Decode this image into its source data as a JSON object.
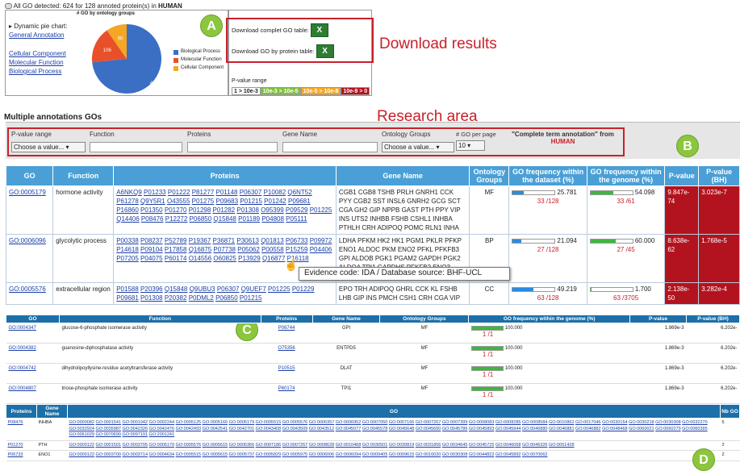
{
  "header": {
    "icon": "database-icon",
    "prefix": "All GO detected: 624 for 128 annoted protein(s) in",
    "species": "HUMAN"
  },
  "pie": {
    "side_title": "Dynamic pie chart:",
    "links": [
      "General Annotation",
      "Cellular Component",
      "Molecular Function",
      "Biological Process"
    ],
    "chart_title": "# GO by ontology groups"
  },
  "chart_data": {
    "type": "pie",
    "title": "# GO by ontology groups",
    "labels": [
      "Biological Process",
      "Molecular Function",
      "Cellular Component"
    ],
    "values": [
      458,
      106,
      60
    ],
    "colors": [
      "#3a6fc4",
      "#e8502a",
      "#f5a623"
    ]
  },
  "download": {
    "complete_label": "Download complet GO table:",
    "byprotein_label": "Download GO by protein table:",
    "xls_icon": "excel-icon",
    "pvalue_title": "P-value range",
    "pvalue_bins": [
      {
        "t": "1 > 10e-3",
        "c": "#ffffff",
        "f": "#222"
      },
      {
        "t": "10e-3 > 10e-5",
        "c": "#7fbf3f",
        "f": "#fff"
      },
      {
        "t": "10e-5 > 10e-8",
        "c": "#f5a623",
        "f": "#fff"
      },
      {
        "t": "10e-9 > 0",
        "c": "#b3131e",
        "f": "#fff"
      }
    ]
  },
  "annotations": {
    "A": "Download results",
    "B": "Research area",
    "letters": [
      "A",
      "B",
      "C",
      "D"
    ]
  },
  "search": {
    "title": "Multiple annotations GOs",
    "pvalue_label": "P-value range",
    "pvalue_select": "Choose a value...",
    "function_label": "Function",
    "proteins_label": "Proteins",
    "gene_label": "Gene Name",
    "onto_label": "Ontology Groups",
    "onto_select": "Choose a value...",
    "goperpage_label": "# GO per page",
    "goperpage_value": "10",
    "complete_label": "\"Complete term annotation\" from",
    "complete_species": "HUMAN"
  },
  "table1": {
    "headers": [
      "GO",
      "Function",
      "Proteins",
      "Gene Name",
      "Ontology Groups",
      "GO frequency within the dataset (%)",
      "GO frequency within the genome (%)",
      "P-value",
      "P-value (BH)"
    ],
    "rows": [
      {
        "go": "GO:0005179",
        "function": "hormone activity",
        "proteins": "A6NKQ9 P01233 P01222 P81277 P01148 P06307 P10082 Q6NT52 P61278 Q9Y5R1 O43555 P01275 P09683 P01215 P01242 P09681 P16860 P01350 P01270 P01298 P01282 P01308 O95399 P09529 P01225 Q14406 P08476 P12272 P06850 Q15848 P01189 P04808 P05111",
        "gene": "CGB1 CGB8 TSHB PRLH GNRH1 CCK PYY CGB2 SST INSL6 GNRH2 GCG SCT CGA GH2 GIP NPPB GAST PTH PPY VIP INS UTS2 INHBB FSHB CSHL1 INHBA PTHLH CRH ADIPOQ POMC RLN1 INHA",
        "onto": "MF",
        "ds_pct": "25.781",
        "ds_frac": "33 /128",
        "ds_val": 25.781,
        "gn_pct": "54.098",
        "gn_frac": "33 /61",
        "gn_val": 54.098,
        "p": "9.847e-74",
        "pbh": "3.023e-7"
      },
      {
        "go": "GO:0006096",
        "function": "glycolytic process",
        "proteins": "P00338 P08237 P52789 P19367 P36871 P30613 Q01813 P06733 P09972 P14618 P09104 P17858 Q16875 P07738 P05062 P00558 P15259 P04406 P07205 P04075 P60174 O14556 O60825 P13929 Q16877 P16118",
        "gene": "LDHA PFKM HK2 HK1 PGM1 PKLR PFKP ENO1 ALDOC PKM ENO2 PFKL PFKFB3 GPI ALDOB PGK1 PGAM2 GAPDH PGK2 ALDOA TPI1 GAPDHS PFKFB2 ENO3 PFKFB1 PFKFB4",
        "onto": "BP",
        "ds_pct": "21.094",
        "ds_frac": "27 /128",
        "ds_val": 21.094,
        "gn_pct": "60.000",
        "gn_frac": "27 /45",
        "gn_val": 60,
        "p": "8.638e-62",
        "pbh": "1.768e-5"
      },
      {
        "go": "GO:0005576",
        "function": "extracellular region",
        "proteins": "P01588 P20396 Q15848 Q9UBU3 P06307 Q9UEF7 P01225 P01229 P09681 P01308 P20382 P0DML2 P06850 P01215",
        "gene": "EPO TRH ADIPOQ GHRL CCK KL FSHB LHB GIP INS PMCH CSH1 CRH CGA VIP",
        "onto": "CC",
        "ds_pct": "49.219",
        "ds_frac": "63 /128",
        "ds_val": 49.219,
        "gn_pct": "1.700",
        "gn_frac": "63 /3705",
        "gn_val": 1.7,
        "p": "2.138e-50",
        "pbh": "3.282e-4"
      }
    ]
  },
  "tooltip": "Evidence code: IDA / Database source: BHF-UCL",
  "table2": {
    "headers": [
      "GO",
      "Function",
      "Proteins",
      "Gene Name",
      "Ontology Groups",
      "GO frequency within the genome (%)",
      "P-value",
      "P-value (BH)"
    ],
    "rows": [
      {
        "go": "GO:0004347",
        "function": "glucose-6-phosphate isomerase activity",
        "protein": "P06744",
        "gene": "GPI",
        "onto": "MF",
        "pct": "100.000",
        "frac": "1 /1",
        "p": "1.869e-3",
        "pbh": "6.202e-"
      },
      {
        "go": "GO:0004382",
        "function": "guanosine-diphosphatase activity",
        "protein": "O75356",
        "gene": "ENTPD5",
        "onto": "MF",
        "pct": "100.000",
        "frac": "1 /1",
        "p": "1.869e-3",
        "pbh": "6.202e-"
      },
      {
        "go": "GO:0004742",
        "function": "dihydrolipoyllysine-residue acetyltransferase activity",
        "protein": "P10515",
        "gene": "DLAT",
        "onto": "MF",
        "pct": "100.000",
        "frac": "1 /1",
        "p": "1.869e-3",
        "pbh": "6.202e-"
      },
      {
        "go": "GO:0004807",
        "function": "triose-phosphate isomerase activity",
        "protein": "P60174",
        "gene": "TPI1",
        "onto": "MF",
        "pct": "100.000",
        "frac": "1 /1",
        "p": "1.869e-3",
        "pbh": "6.202e-"
      }
    ]
  },
  "table3": {
    "headers": [
      "Proteins",
      "Gene Name",
      "GO",
      "Nb GO"
    ],
    "rows": [
      {
        "protein": "P08476",
        "gene": "INHBA",
        "gos": "GO:0000082 GO:0001541 GO:0001942 GO:0002244 GO:0005125 GO:0005160 GO:0005179 GO:0005515 GO:0005576 GO:0006357 GO:0006952 GO:0007050 GO:0007166 GO:0007267 GO:0007399 GO:0008083 GO:0008285 GO:0008584 GO:0010862 GO:0017046 GO:0030154 GO:0030218 GO:0030308 GO:0032270 GO:0032924 GO:0035987 GO:0042326 GO:0042476 GO:0042493 GO:0042541 GO:0042701 GO:0043408 GO:0043509 GO:0043512 GO:0045077 GO:0045578 GO:0045648 GO:0045650 GO:0045786 GO:0045893 GO:0045944 GO:0046880 GO:0046881 GO:0046882 GO:0048468 GO:0060021 GO:0060279 GO:0060395 GO:0061029 GO:0070699 GO:0097191 GO:2001241",
        "nb": "5"
      },
      {
        "protein": "P01270",
        "gene": "PTH",
        "gos": "GO:0000122 GO:0001501 GO:0003705 GO:0005179 GO:0005576 GO:0005615 GO:0006366 GO:0007186 GO:0007267 GO:0008628 GO:0010468 GO:0030501 GO:0030819 GO:0031856 GO:0034645 GO:0045725 GO:0046058 GO:0046326 GO:0051428",
        "nb": "2"
      },
      {
        "protein": "P06733",
        "gene": "ENO1",
        "gos": "GO:0000122 GO:0003700 GO:0003714 GO:0004634 GO:0005515 GO:0005615 GO:0005737 GO:0005829 GO:0005975 GO:0006006 GO:0006094 GO:0009405 GO:0009615 GO:0016020 GO:0030308 GO:0044822 GO:0045892 GO:0070062",
        "nb": "2"
      }
    ]
  }
}
